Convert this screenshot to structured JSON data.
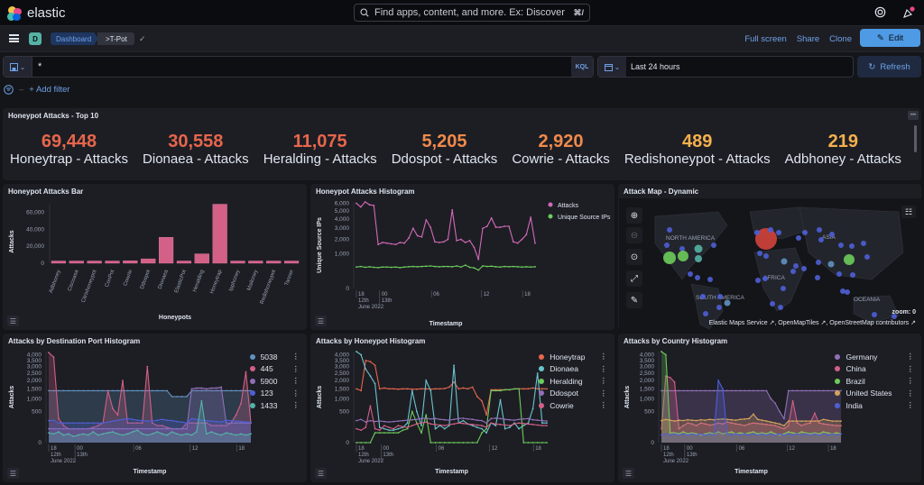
{
  "app": {
    "name": "elastic"
  },
  "global_search": {
    "placeholder": "Find apps, content, and more. Ex: Discover",
    "shortcut": "⌘/"
  },
  "nav": {
    "space_initial": "D",
    "breadcrumbs": [
      "Dashboard",
      ">T-Pot"
    ],
    "actions": {
      "full_screen": "Full screen",
      "share": "Share",
      "clone": "Clone",
      "edit": "Edit"
    }
  },
  "query": {
    "value": "*",
    "language": "KQL"
  },
  "time": {
    "range": "Last 24 hours",
    "refresh": "Refresh"
  },
  "filters": {
    "add_filter": "+ Add filter"
  },
  "colors": {
    "accent": "#4e9ae5",
    "link": "#6fa1e7",
    "panel": "#1d1e24",
    "bg": "#141519"
  },
  "top10": {
    "title": "Honeypot Attacks - Top 10",
    "metrics": [
      {
        "value": "69,448",
        "label": "Honeytrap - Attacks",
        "color": "#e7664c"
      },
      {
        "value": "30,558",
        "label": "Dionaea - Attacks",
        "color": "#e7664c"
      },
      {
        "value": "11,075",
        "label": "Heralding - Attacks",
        "color": "#e7664c"
      },
      {
        "value": "5,205",
        "label": "Ddospot - Attacks",
        "color": "#f08a4b"
      },
      {
        "value": "2,920",
        "label": "Cowrie - Attacks",
        "color": "#f08a4b"
      },
      {
        "value": "489",
        "label": "Redishoneypot - Attacks",
        "color": "#f5b04d"
      },
      {
        "value": "219",
        "label": "Adbhoney - Attacks",
        "color": "#f5b04d"
      }
    ]
  },
  "panels": {
    "bar": {
      "title": "Honeypot Attacks Bar"
    },
    "histogram": {
      "title": "Honeypot Attacks Histogram"
    },
    "map": {
      "title": "Attack Map - Dynamic",
      "labels": [
        "NORTH AMERICA",
        "SOUTH AMERICA",
        "AFRICA",
        "ASIA",
        "OCEANIA"
      ],
      "zoom_label": "zoom: 0",
      "attribution": "Elastic Maps Service ↗, OpenMapTiles ↗, OpenStreetMap contributors ↗"
    },
    "port": {
      "title": "Attacks by Destination Port Histogram"
    },
    "honeypot": {
      "title": "Attacks by Honeypot Histogram"
    },
    "country": {
      "title": "Attacks by Country Histogram"
    }
  },
  "chart_data": [
    {
      "id": "bar",
      "type": "bar",
      "title": "Honeypot Attacks Bar",
      "xlabel": "Honeypots",
      "ylabel": "Attacks",
      "categories": [
        "Adbhoney",
        "Ciscoasa",
        "Citrixhoneypot",
        "ConPot",
        "Cowrie",
        "Ddospot",
        "Dionaea",
        "ElasticPot",
        "Heralding",
        "Honeytrap",
        "Ipphoney",
        "Mailoney",
        "Redishoneypot",
        "Tanner"
      ],
      "values": [
        219,
        40,
        30,
        25,
        2920,
        5205,
        30558,
        20,
        11075,
        69448,
        30,
        120,
        489,
        100
      ],
      "yticks": [
        "0",
        "20,000",
        "40,000",
        "60,000"
      ],
      "color": "#d36086"
    },
    {
      "id": "histogram",
      "type": "line",
      "title": "Honeypot Attacks Histogram",
      "xlabel": "Timestamp",
      "ylabel": "Unique Source IPs",
      "yticks": [
        "0",
        "1,000",
        "2,000",
        "3,000",
        "4,000",
        "5,000",
        "6,000"
      ],
      "xticks": [
        "18\n12th\nJune 2022",
        "00\n13th",
        "06",
        "12",
        "18"
      ],
      "series": [
        {
          "name": "Attacks",
          "color": "#d36ab8",
          "values": [
            6000,
            5500,
            6200,
            5800,
            5700,
            1600,
            1750,
            1700,
            1650,
            1600,
            1750,
            1700,
            2100,
            3000,
            2300,
            2200,
            3900,
            3100,
            1800,
            1750,
            1800,
            2000,
            5100,
            1900,
            2000,
            1750,
            1900,
            1400,
            700,
            3000,
            3200,
            4100,
            3100,
            3100,
            3200,
            3200,
            1800,
            1700,
            2000,
            2400,
            4200,
            1700
          ]
        },
        {
          "name": "Unique Source IPs",
          "color": "#6dcc5a",
          "values": [
            380,
            400,
            370,
            390,
            370,
            360,
            380,
            380,
            370,
            380,
            360,
            380,
            390,
            400,
            390,
            400,
            410,
            420,
            400,
            390,
            400,
            400,
            390,
            420,
            380,
            450,
            370,
            350,
            280,
            420,
            400,
            410,
            390,
            380,
            400,
            390,
            400,
            390,
            380,
            390,
            380,
            390
          ]
        }
      ]
    },
    {
      "id": "port",
      "type": "area",
      "title": "Attacks by Destination Port Histogram",
      "xlabel": "Timestamp",
      "ylabel": "Attacks",
      "yticks": [
        "0",
        "500",
        "1,000",
        "1,500",
        "2,000",
        "2,500",
        "3,000",
        "3,500",
        "4,000"
      ],
      "series": [
        {
          "name": "5038",
          "color": "#6092c0",
          "values": [
            1400,
            1400,
            1400,
            1400,
            1400,
            1400,
            1400,
            1400,
            1400,
            1400,
            1400,
            1400,
            1400,
            1400,
            1400,
            1400,
            1400,
            1400,
            1400,
            1400,
            1400,
            1400,
            1400,
            1400,
            1400,
            1100,
            1100,
            1100,
            1100,
            1400,
            1400,
            1400,
            1400,
            1400,
            1400,
            1400,
            1400,
            1400,
            1400,
            1400,
            1400,
            1400
          ]
        },
        {
          "name": "445",
          "color": "#d36086",
          "values": [
            4200,
            3800,
            300,
            150,
            100,
            100,
            100,
            100,
            100,
            120,
            150,
            200,
            1400,
            600,
            400,
            2000,
            200,
            200,
            200,
            200,
            3000,
            200,
            150,
            150,
            120,
            100,
            100,
            100,
            200,
            200,
            200,
            200,
            200,
            150,
            150,
            150,
            150,
            200,
            400,
            800,
            2600,
            200
          ]
        },
        {
          "name": "5900",
          "color": "#9170b8",
          "values": [
            100,
            100,
            100,
            100,
            100,
            100,
            100,
            100,
            100,
            100,
            100,
            100,
            100,
            100,
            100,
            100,
            100,
            100,
            100,
            100,
            100,
            100,
            100,
            100,
            100,
            100,
            100,
            100,
            100,
            1500,
            1550,
            1550,
            1500,
            1550,
            1550,
            1600,
            200,
            200,
            200,
            200,
            200,
            200
          ]
        },
        {
          "name": "123",
          "color": "#4e5fd6",
          "values": [
            250,
            260,
            200,
            200,
            200,
            200,
            200,
            200,
            200,
            200,
            200,
            200,
            220,
            240,
            260,
            280,
            300,
            280,
            260,
            250,
            240,
            240,
            260,
            280,
            260,
            250,
            230,
            220,
            200,
            300,
            280,
            260,
            250,
            240,
            230,
            220,
            260,
            250,
            240,
            230,
            220,
            220
          ]
        },
        {
          "name": "1433",
          "color": "#54b3a5",
          "values": [
            50,
            40,
            60,
            30,
            40,
            20,
            30,
            40,
            30,
            60,
            30,
            40,
            50,
            60,
            40,
            30,
            40,
            60,
            80,
            40,
            30,
            40,
            60,
            40,
            30,
            60,
            40,
            30,
            40,
            30,
            60,
            900,
            40,
            60,
            40,
            30,
            50,
            40,
            30,
            40,
            30,
            40
          ]
        }
      ]
    },
    {
      "id": "honeypot",
      "type": "line",
      "title": "Attacks by Honeypot Histogram",
      "xlabel": "Timestamp",
      "ylabel": "Attacks",
      "yticks": [
        "0",
        "500",
        "1,000",
        "1,500",
        "2,000",
        "2,500",
        "3,000",
        "3,500",
        "4,000"
      ],
      "series": [
        {
          "name": "Honeytrap",
          "color": "#e7664c",
          "values": [
            1500,
            1400,
            3500,
            3400,
            3100,
            1500,
            1550,
            1500,
            1500,
            1480,
            1500,
            1500,
            1480,
            1480,
            1500,
            1500,
            1480,
            1500,
            1500,
            1520,
            1600,
            1900,
            1500,
            1550,
            1500,
            1600,
            1100,
            900,
            400,
            1450,
            1450,
            1450,
            1450,
            1450,
            1500,
            1500,
            1500,
            1500,
            1550,
            1500,
            1500,
            1500
          ]
        },
        {
          "name": "Dionaea",
          "color": "#69c4cf",
          "values": [
            4300,
            4000,
            2800,
            2300,
            1800,
            120,
            100,
            80,
            80,
            100,
            120,
            200,
            1400,
            500,
            150,
            2000,
            1400,
            100,
            150,
            100,
            150,
            3100,
            200,
            250,
            180,
            150,
            120,
            100,
            50,
            200,
            150,
            950,
            100,
            120,
            200,
            100,
            150,
            200,
            600,
            2500,
            200,
            200
          ]
        },
        {
          "name": "Heralding",
          "color": "#6dcc5a",
          "values": [
            0,
            0,
            0,
            0,
            50,
            50,
            50,
            50,
            50,
            50,
            80,
            100,
            500,
            200,
            50,
            400,
            0,
            0,
            0,
            0,
            0,
            0,
            0,
            0,
            0,
            0,
            0,
            50,
            100,
            1400,
            1400,
            1400,
            1450,
            1450,
            1500,
            1500,
            0,
            0,
            0,
            0,
            0,
            0
          ]
        },
        {
          "name": "Ddospot",
          "color": "#9170b8",
          "values": [
            250,
            280,
            220,
            250,
            230,
            240,
            230,
            220,
            230,
            240,
            250,
            260,
            270,
            280,
            300,
            310,
            290,
            300,
            280,
            270,
            260,
            280,
            300,
            310,
            290,
            280,
            260,
            250,
            200,
            300,
            310,
            300,
            280,
            270,
            260,
            280,
            290,
            300,
            270,
            260,
            250,
            240
          ]
        },
        {
          "name": "Cowrie",
          "color": "#d36086",
          "values": [
            100,
            80,
            120,
            700,
            100,
            80,
            150,
            120,
            100,
            150,
            130,
            120,
            150,
            180,
            200,
            220,
            180,
            170,
            160,
            150,
            170,
            180,
            200,
            190,
            180,
            170,
            160,
            150,
            120,
            200,
            180,
            170,
            160,
            150,
            180,
            200,
            190,
            180,
            170,
            160,
            150,
            150
          ]
        }
      ]
    },
    {
      "id": "country",
      "type": "area",
      "title": "Attacks by Country Histogram",
      "xlabel": "Timestamp",
      "ylabel": "Attacks",
      "yticks": [
        "0",
        "500",
        "1,000",
        "1,500",
        "2,000",
        "2,500",
        "3,000",
        "3,500",
        "4,000"
      ],
      "series": [
        {
          "name": "Germany",
          "color": "#9170b8",
          "values": [
            1400,
            1400,
            1400,
            1400,
            1400,
            1400,
            1400,
            1400,
            1400,
            1400,
            1400,
            1400,
            1400,
            1400,
            1400,
            1400,
            1400,
            1400,
            1400,
            1400,
            1400,
            1400,
            1400,
            1400,
            1400,
            1000,
            800,
            500,
            300,
            1400,
            1400,
            1400,
            1400,
            1400,
            1400,
            1400,
            1400,
            1400,
            1400,
            1400,
            1400,
            1400
          ]
        },
        {
          "name": "China",
          "color": "#d36086",
          "values": [
            100,
            2300,
            2200,
            1900,
            100,
            150,
            200,
            180,
            150,
            200,
            180,
            160,
            170,
            200,
            180,
            220,
            200,
            180,
            170,
            150,
            180,
            200,
            190,
            180,
            170,
            160,
            150,
            120,
            100,
            150,
            900,
            200,
            150,
            180,
            200,
            450,
            200,
            180,
            170,
            160,
            150,
            150
          ]
        },
        {
          "name": "Brazil",
          "color": "#6dcc5a",
          "values": [
            4300,
            4000,
            50,
            50,
            40,
            60,
            40,
            50,
            40,
            30,
            40,
            50,
            40,
            60,
            40,
            50,
            60,
            40,
            50,
            40,
            50,
            60,
            40,
            50,
            40,
            60,
            40,
            30,
            40,
            60,
            50,
            40,
            60,
            50,
            40,
            50,
            40,
            60,
            50,
            40,
            50,
            40
          ]
        },
        {
          "name": "United States",
          "color": "#d6a35c",
          "values": [
            250,
            280,
            260,
            240,
            260,
            250,
            270,
            260,
            250,
            270,
            260,
            280,
            270,
            280,
            290,
            280,
            270,
            260,
            280,
            290,
            300,
            420,
            280,
            260,
            240,
            220,
            200,
            180,
            150,
            240,
            240,
            240,
            240,
            240,
            240,
            240,
            240,
            280,
            260,
            240,
            240,
            240
          ]
        },
        {
          "name": "India",
          "color": "#4e5fd6",
          "values": [
            30,
            40,
            30,
            40,
            30,
            40,
            30,
            40,
            30,
            40,
            30,
            40,
            30,
            2000,
            1500,
            40,
            30,
            40,
            30,
            40,
            30,
            40,
            30,
            40,
            30,
            40,
            30,
            40,
            30,
            40,
            30,
            40,
            30,
            40,
            30,
            40,
            30,
            40,
            30,
            40,
            30,
            40
          ]
        }
      ]
    }
  ]
}
